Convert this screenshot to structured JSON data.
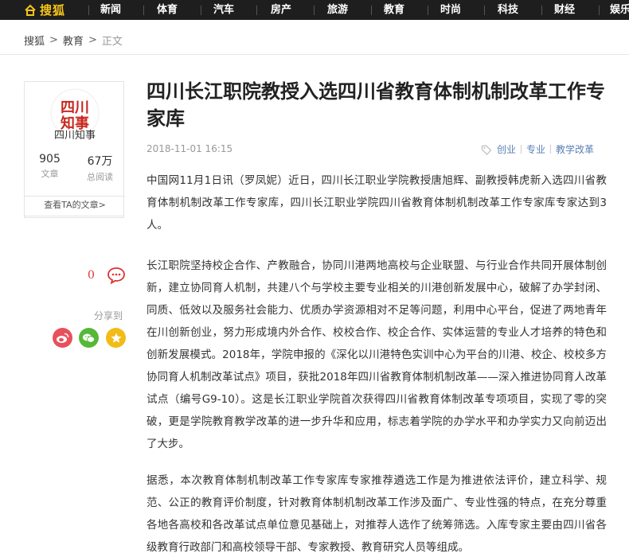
{
  "topnav": {
    "brand": "搜狐",
    "items": [
      "新闻",
      "体育",
      "汽车",
      "房产",
      "旅游",
      "教育",
      "时尚",
      "科技",
      "财经",
      "娱乐"
    ]
  },
  "breadcrumb": {
    "home": "搜狐",
    "section": "教育",
    "current": "正文",
    "separator": ">"
  },
  "author": {
    "avatar_text": "四川知事",
    "name": "四川知事",
    "articles_count": "905",
    "articles_label": "文章",
    "reads_count": "67万",
    "reads_label": "总阅读",
    "view_link": "查看TA的文章>"
  },
  "actions": {
    "comment_count": "0",
    "share_label": "分享到"
  },
  "article": {
    "title": "四川长江职院教授入选四川省教育体制机制改革工作专家库",
    "date": "2018-11-01 16:15",
    "tags": [
      "创业",
      "专业",
      "教学改革"
    ],
    "paragraphs": [
      "中国网11月1日讯（罗凤妮）近日，四川长江职业学院教授唐旭辉、副教授韩虎新入选四川省教育体制机制改革工作专家库，四川长江职业学院四川省教育体制机制改革工作专家库专家达到3人。",
      "长江职院坚持校企合作、产教融合，协同川港两地高校与企业联盟、与行业合作共同开展体制创新，建立协同育人机制，共建八个与学校主要专业相关的川港创新发展中心，破解了办学封闭、同质、低效以及服务社会能力、优质办学资源相对不足等问题，利用中心平台，促进了两地青年在川创新创业，努力形成境内外合作、校校合作、校企合作、实体运营的专业人才培养的特色和创新发展模式。2018年，学院申报的《深化以川港特色实训中心为平台的川港、校企、校校多方协同育人机制改革试点》项目，获批2018年四川省教育体制机制改革——深入推进协同育人改革试点（编号G9-10）。这是长江职业学院首次获得四川省教育体制改革专项项目，实现了零的突破，更是学院教育教学改革的进一步升华和应用，标志着学院的办学水平和办学实力又向前迈出了大步。",
      "据悉，本次教育体制机制改革工作专家库专家推荐遴选工作是为推进依法评价，建立科学、规范、公正的教育评价制度，针对教育体制机制改革工作涉及面广、专业性强的特点，在充分尊重各地各高校和各改革试点单位意见基础上，对推荐人选作了统筹筛选。入库专家主要由四川省各级教育行政部门和高校领导干部、专家教授、教育研究人员等组成。"
    ]
  },
  "colors": {
    "nav_bg": "#1e1e1e",
    "brand": "#f5c518",
    "tag": "#5a7fb5",
    "avatar_red": "#c8281e",
    "comment_red": "#d33"
  }
}
